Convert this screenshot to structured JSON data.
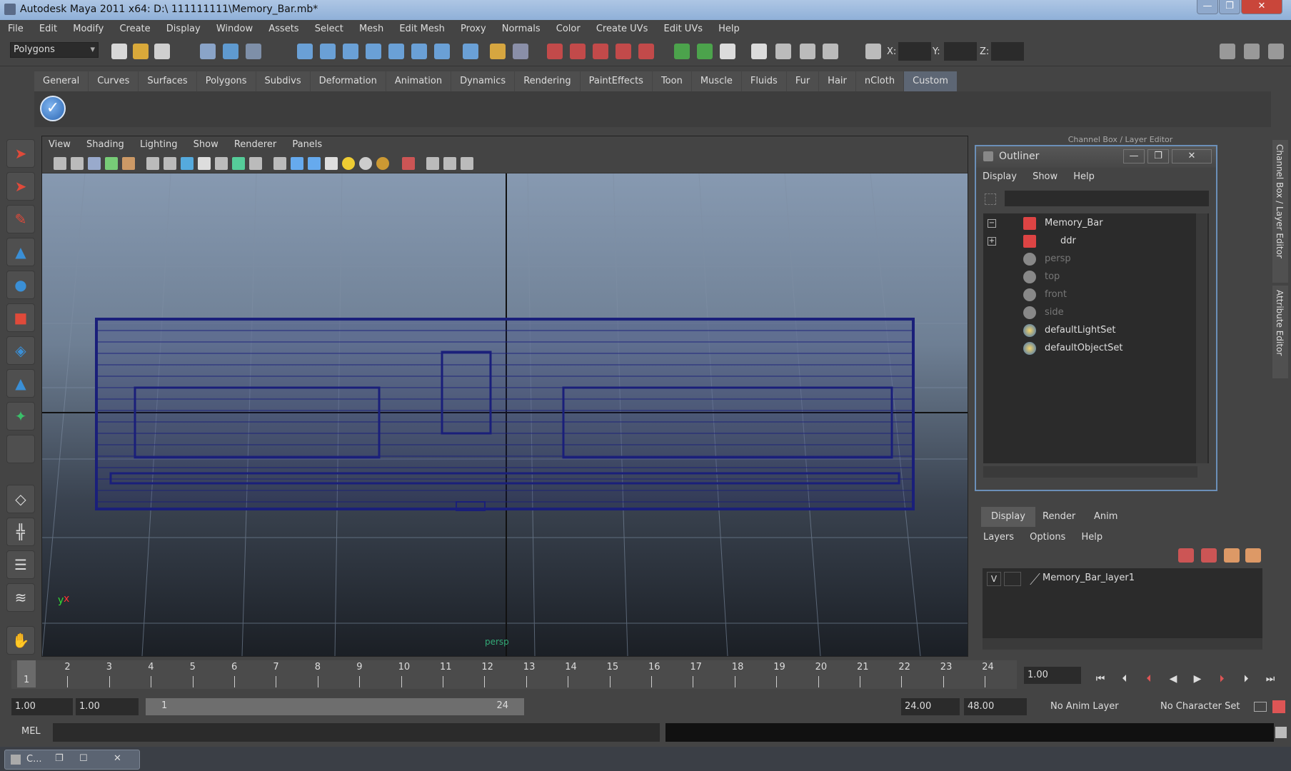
{
  "window": {
    "title": "Autodesk Maya 2011 x64: D:\\ 111111111\\Memory_Bar.mb*",
    "min": "—",
    "max": "❐",
    "close": "✕"
  },
  "menubar": [
    "File",
    "Edit",
    "Modify",
    "Create",
    "Display",
    "Window",
    "Assets",
    "Select",
    "Mesh",
    "Edit Mesh",
    "Proxy",
    "Normals",
    "Color",
    "Create UVs",
    "Edit UVs",
    "Help"
  ],
  "statusline": {
    "mode": "Polygons",
    "x_label": "X:",
    "y_label": "Y:",
    "z_label": "Z:"
  },
  "shelf": {
    "tabs": [
      "General",
      "Curves",
      "Surfaces",
      "Polygons",
      "Subdivs",
      "Deformation",
      "Animation",
      "Dynamics",
      "Rendering",
      "PaintEffects",
      "Toon",
      "Muscle",
      "Fluids",
      "Fur",
      "Hair",
      "nCloth",
      "Custom"
    ],
    "active": "Custom"
  },
  "viewport": {
    "menus": [
      "View",
      "Shading",
      "Lighting",
      "Show",
      "Renderer",
      "Panels"
    ],
    "camera_label": "persp",
    "axis_y": "y",
    "axis_x": "x"
  },
  "channelbox_title": "Channel Box / Layer Editor",
  "side_tabs": [
    "Channel Box / Layer Editor",
    "Attribute Editor"
  ],
  "outliner": {
    "title": "Outliner",
    "menus": [
      "Display",
      "Show",
      "Help"
    ],
    "items": [
      {
        "label": "Memory_Bar",
        "dim": false,
        "type": "mesh"
      },
      {
        "label": "ddr",
        "dim": false,
        "type": "mesh"
      },
      {
        "label": "persp",
        "dim": true,
        "type": "camera"
      },
      {
        "label": "top",
        "dim": true,
        "type": "camera"
      },
      {
        "label": "front",
        "dim": true,
        "type": "camera"
      },
      {
        "label": "side",
        "dim": true,
        "type": "camera"
      },
      {
        "label": "defaultLightSet",
        "dim": false,
        "type": "set"
      },
      {
        "label": "defaultObjectSet",
        "dim": false,
        "type": "set"
      }
    ]
  },
  "layer_editor": {
    "tabs": [
      "Display",
      "Render",
      "Anim"
    ],
    "menus": [
      "Layers",
      "Options",
      "Help"
    ],
    "layer": {
      "visible": "V",
      "name": "Memory_Bar_layer1"
    }
  },
  "timeslider": {
    "ticks": [
      "1",
      "2",
      "3",
      "4",
      "5",
      "6",
      "7",
      "8",
      "9",
      "10",
      "11",
      "12",
      "13",
      "14",
      "15",
      "16",
      "17",
      "18",
      "19",
      "20",
      "21",
      "22",
      "23",
      "24"
    ],
    "current_marker": "1",
    "current_frame": "1.00"
  },
  "range": {
    "start_time": "1.00",
    "start_playback": "1.00",
    "range_start": "1",
    "range_end": "24",
    "end_playback": "24.00",
    "end_time": "48.00",
    "anim_layer": "No Anim Layer",
    "char_set": "No Character Set"
  },
  "command": {
    "label": "MEL"
  },
  "taskbar": {
    "label": "C..."
  },
  "colors": {
    "accent": "#6b8fb8",
    "wire": "#1a1f7a",
    "shelf_active": "#5d6674"
  }
}
